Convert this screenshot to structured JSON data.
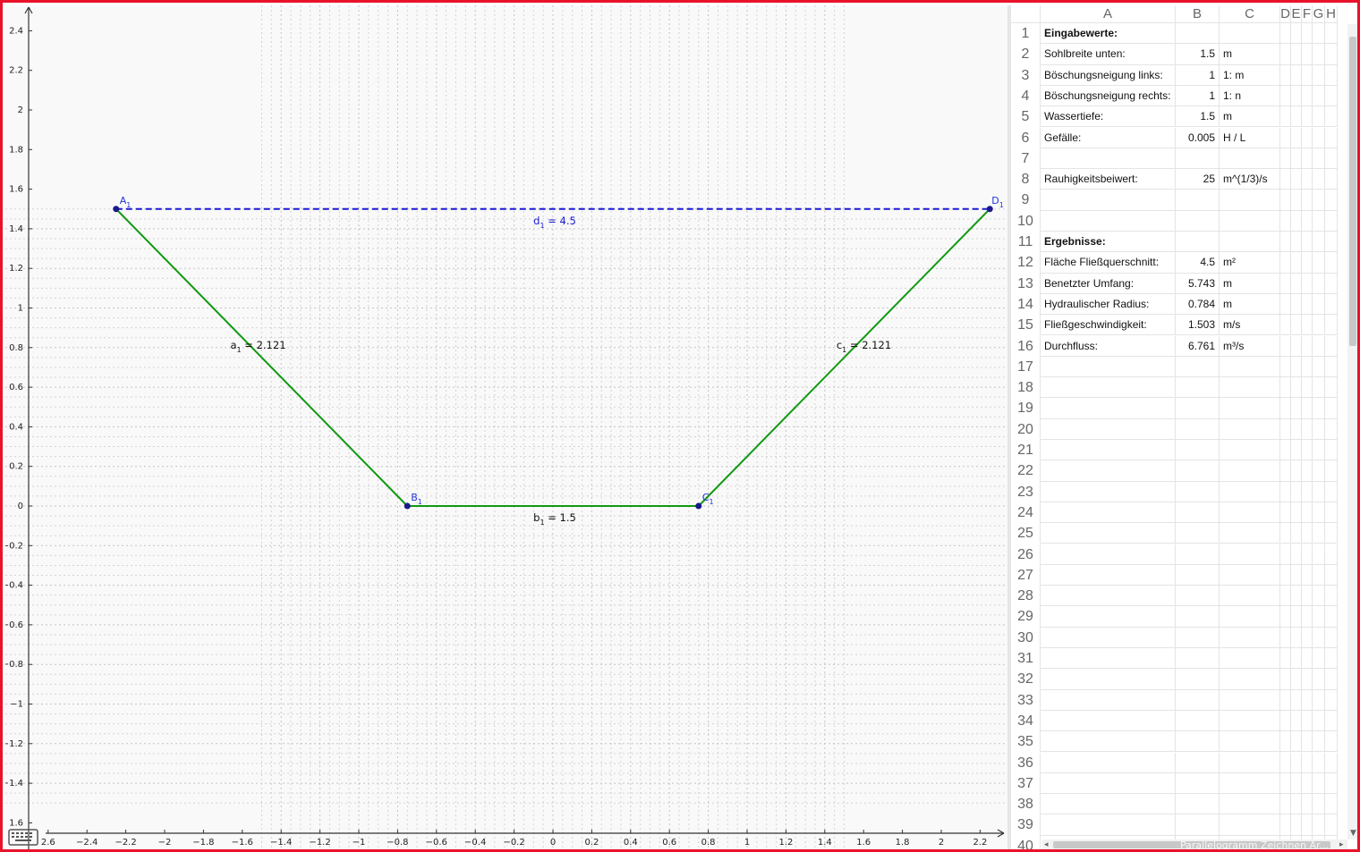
{
  "colors": {
    "frame": "#e8132a",
    "segment": "#119911",
    "dashed": "#1a1ad6",
    "point": "#1a1a8a",
    "point_label": "#2233dd",
    "grid_minor": "#d4d4d4",
    "grid_major": "#c4c4c4",
    "axis": "#333333"
  },
  "graphics": {
    "x_ticks": [
      "2.6",
      "−2.4",
      "−2.2",
      "−2",
      "−1.8",
      "−1.6",
      "−1.4",
      "−1.2",
      "−1",
      "−0.8",
      "−0.6",
      "−0.4",
      "−0.2",
      "0",
      "0.2",
      "0.4",
      "0.6",
      "0.8",
      "1",
      "1.2",
      "1.4",
      "1.6",
      "1.8",
      "2",
      "2.2"
    ],
    "y_ticks": [
      "2.4",
      "2.2",
      "2",
      "1.8",
      "1.6",
      "1.4",
      "1.2",
      "1",
      "0.8",
      "0.6",
      "0.4",
      "0.2",
      "0",
      "−0.2",
      "−0.4",
      "−0.6",
      "−0.8",
      "−1",
      "−1.2",
      "−1.4",
      "1.6"
    ],
    "points": [
      {
        "name": "A",
        "sub": "1",
        "x": -2.25,
        "y": 1.5
      },
      {
        "name": "B",
        "sub": "1",
        "x": -0.75,
        "y": 0
      },
      {
        "name": "C",
        "sub": "1",
        "x": 0.75,
        "y": 0
      },
      {
        "name": "D",
        "sub": "1",
        "x": 2.25,
        "y": 1.5
      }
    ],
    "segments": [
      {
        "name": "a",
        "sub": "1",
        "value": "= 2.121",
        "from": "A",
        "to": "B",
        "style": "solid"
      },
      {
        "name": "b",
        "sub": "1",
        "value": "= 1.5",
        "from": "B",
        "to": "C",
        "style": "solid"
      },
      {
        "name": "c",
        "sub": "1",
        "value": "= 2.121",
        "from": "C",
        "to": "D",
        "style": "solid"
      },
      {
        "name": "d",
        "sub": "1",
        "value": "= 4.5",
        "from": "A",
        "to": "D",
        "style": "dashed"
      }
    ]
  },
  "spreadsheet": {
    "columns": [
      "A",
      "B",
      "C",
      "D",
      "E",
      "F",
      "G",
      "H"
    ],
    "row_numbers": [
      "1",
      "2",
      "3",
      "4",
      "5",
      "6",
      "7",
      "8",
      "9",
      "10",
      "11",
      "12",
      "13",
      "14",
      "15",
      "16",
      "17",
      "18",
      "19",
      "20",
      "21",
      "22",
      "23",
      "24",
      "25",
      "26",
      "27",
      "28",
      "29",
      "30",
      "31",
      "32",
      "33",
      "34",
      "35",
      "36",
      "37",
      "38",
      "39",
      "40"
    ],
    "rows": [
      {
        "a": "Eingabewerte:",
        "b": "",
        "c": "",
        "bold": true
      },
      {
        "a": "Sohlbreite unten:",
        "b": "1.5",
        "c": "m"
      },
      {
        "a": "Böschungsneigung links:",
        "b": "1",
        "c": "1: m"
      },
      {
        "a": "Böschungsneigung rechts:",
        "b": "1",
        "c": "1: n"
      },
      {
        "a": "Wassertiefe:",
        "b": "1.5",
        "c": "m"
      },
      {
        "a": "Gefälle:",
        "b": "0.005",
        "c": "H / L"
      },
      {
        "a": "",
        "b": "",
        "c": ""
      },
      {
        "a": "Rauhigkeitsbeiwert:",
        "b": "25",
        "c": "m^(1/3)/s"
      },
      {
        "a": "",
        "b": "",
        "c": ""
      },
      {
        "a": "",
        "b": "",
        "c": ""
      },
      {
        "a": "Ergebnisse:",
        "b": "",
        "c": "",
        "bold": true
      },
      {
        "a": "Fläche Fließquerschnitt:",
        "b": "4.5",
        "c": "m²"
      },
      {
        "a": "Benetzter Umfang:",
        "b": "5.743",
        "c": "m"
      },
      {
        "a": "Hydraulischer Radius:",
        "b": "0.784",
        "c": "m"
      },
      {
        "a": "Fließgeschwindigkeit:",
        "b": "1.503",
        "c": "m/s"
      },
      {
        "a": "Durchfluss:",
        "b": "6.761",
        "c": "m³/s"
      }
    ]
  },
  "icons": {
    "keyboard": "keyboard-icon",
    "scroll_up": "scroll-up-arrow-icon",
    "scroll_down": "scroll-down-arrow-icon",
    "scroll_left": "scroll-left-arrow-icon",
    "scroll_right": "scroll-right-arrow-icon"
  },
  "watermark": "Parallelogramm Zeichnen Ar..."
}
